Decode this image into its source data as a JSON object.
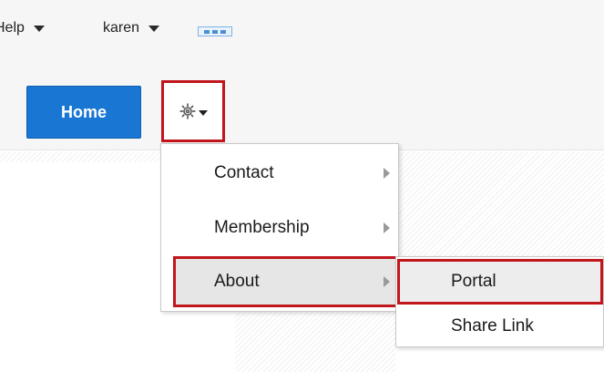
{
  "header": {
    "help_label": "Help",
    "user_label": "karen",
    "more_icon": "more-dots-icon"
  },
  "nav": {
    "home_label": "Home",
    "settings_icon": "gear-icon"
  },
  "menu": {
    "items": [
      {
        "label": "Contact",
        "has_submenu": true
      },
      {
        "label": "Membership",
        "has_submenu": true
      },
      {
        "label": "About",
        "has_submenu": true,
        "highlighted": true
      }
    ]
  },
  "submenu": {
    "items": [
      {
        "label": "Portal",
        "highlighted": true
      },
      {
        "label": "Share Link"
      }
    ]
  },
  "colors": {
    "accent": "#1976d2",
    "highlight_border": "#c0161c"
  }
}
